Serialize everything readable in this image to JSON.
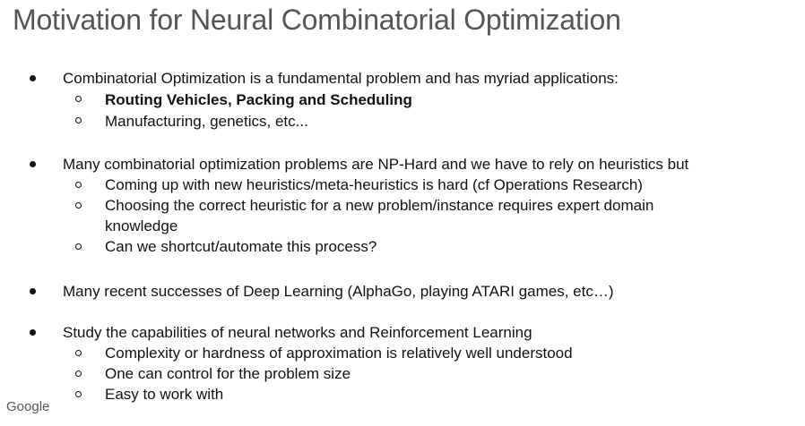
{
  "slide": {
    "title": "Motivation for Neural Combinatorial Optimization",
    "footer_logo": "Google",
    "bullets": [
      {
        "text": "Combinatorial Optimization is a fundamental problem and has myriad applications:",
        "sub": [
          "Routing Vehicles, Packing and Scheduling",
          "Manufacturing, genetics, etc..."
        ]
      },
      {
        "text": "Many combinatorial optimization problems are NP-Hard and we have to rely on heuristics but",
        "sub": [
          "Coming up with new heuristics/meta-heuristics is hard (cf Operations Research)",
          "Choosing the correct heuristic for a new problem/instance requires expert domain",
          "knowledge",
          "Can we shortcut/automate this process?"
        ]
      },
      {
        "text": "Many recent successes of Deep Learning (AlphaGo, playing ATARI games, etc…)"
      },
      {
        "text": "Study the capabilities of neural networks and Reinforcement Learning",
        "sub": [
          "Complexity or hardness of approximation is relatively well understood",
          "One can control for the problem size",
          "Easy to work with"
        ]
      }
    ]
  }
}
